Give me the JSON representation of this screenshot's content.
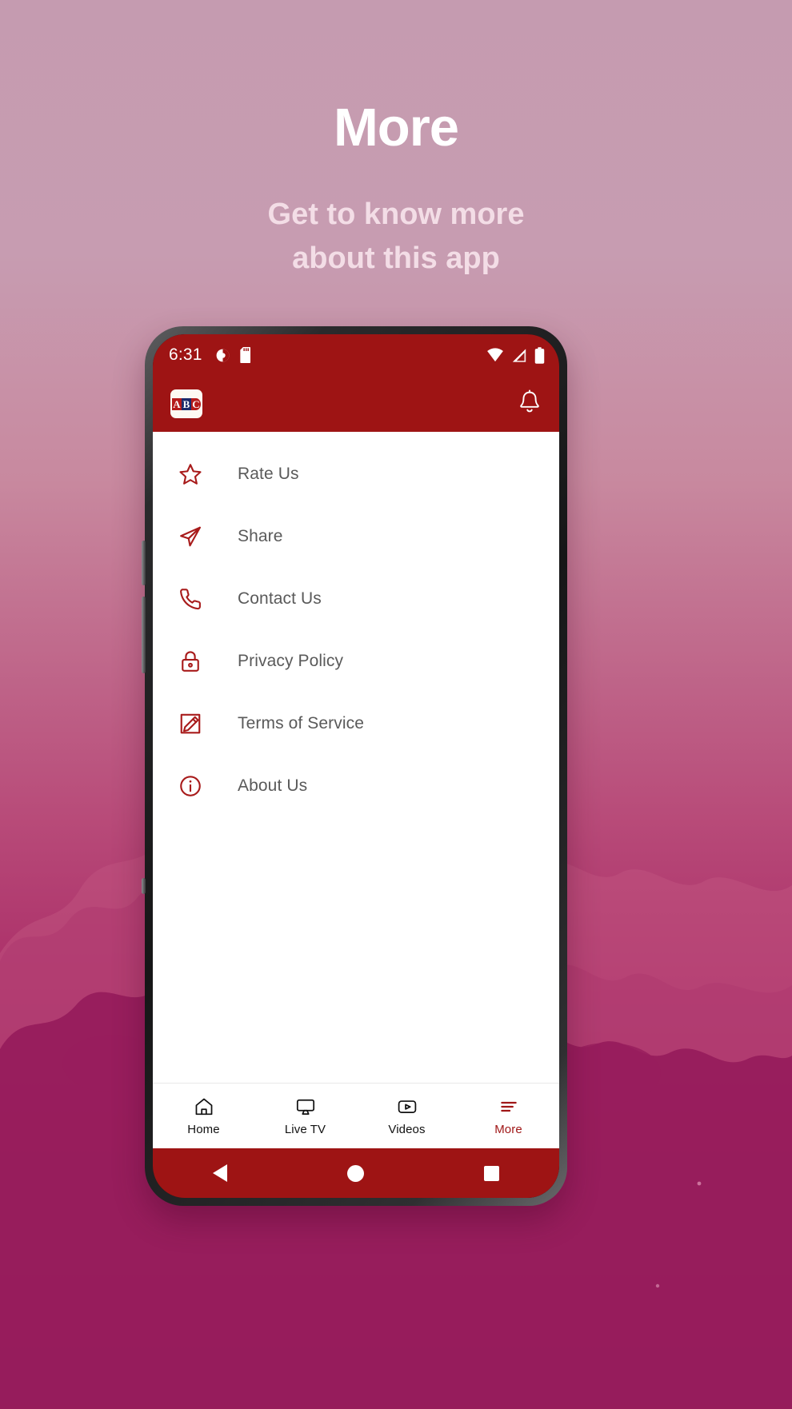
{
  "hero": {
    "title": "More",
    "subtitle_line1": "Get to know more",
    "subtitle_line2": "about this app"
  },
  "colors": {
    "brand_red": "#9E1414",
    "icon_red": "#A81B1B",
    "active_nav": "#A01717",
    "hero_title": "#FFFFFF",
    "hero_subtitle": "#F3DDE6",
    "bg_top": "#C59BB0",
    "bg_bottom": "#7F0847"
  },
  "phone": {
    "status_bar": {
      "time": "6:31",
      "left_icons": [
        "screen-record-icon",
        "sd-card-icon"
      ],
      "right_icons": [
        "wifi-icon",
        "cellular-signal-icon",
        "battery-icon"
      ]
    },
    "app_bar": {
      "logo_letters": [
        "A",
        "B",
        "C"
      ],
      "logo_name": "abc-logo",
      "action_icon": "bell-icon"
    },
    "menu": {
      "items": [
        {
          "icon": "star-icon",
          "label": "Rate Us"
        },
        {
          "icon": "paper-plane-icon",
          "label": "Share"
        },
        {
          "icon": "phone-icon",
          "label": "Contact Us"
        },
        {
          "icon": "lock-icon",
          "label": "Privacy Policy"
        },
        {
          "icon": "pencil-square-icon",
          "label": "Terms of Service"
        },
        {
          "icon": "info-circle-icon",
          "label": "About Us"
        }
      ]
    },
    "bottom_nav": {
      "items": [
        {
          "icon": "home-icon",
          "label": "Home",
          "active": false
        },
        {
          "icon": "tv-icon",
          "label": "Live TV",
          "active": false
        },
        {
          "icon": "video-icon",
          "label": "Videos",
          "active": false
        },
        {
          "icon": "menu-lines-icon",
          "label": "More",
          "active": true
        }
      ]
    },
    "android_nav": {
      "back": "back-triangle-icon",
      "home": "home-circle-icon",
      "recents": "recents-square-icon"
    }
  }
}
